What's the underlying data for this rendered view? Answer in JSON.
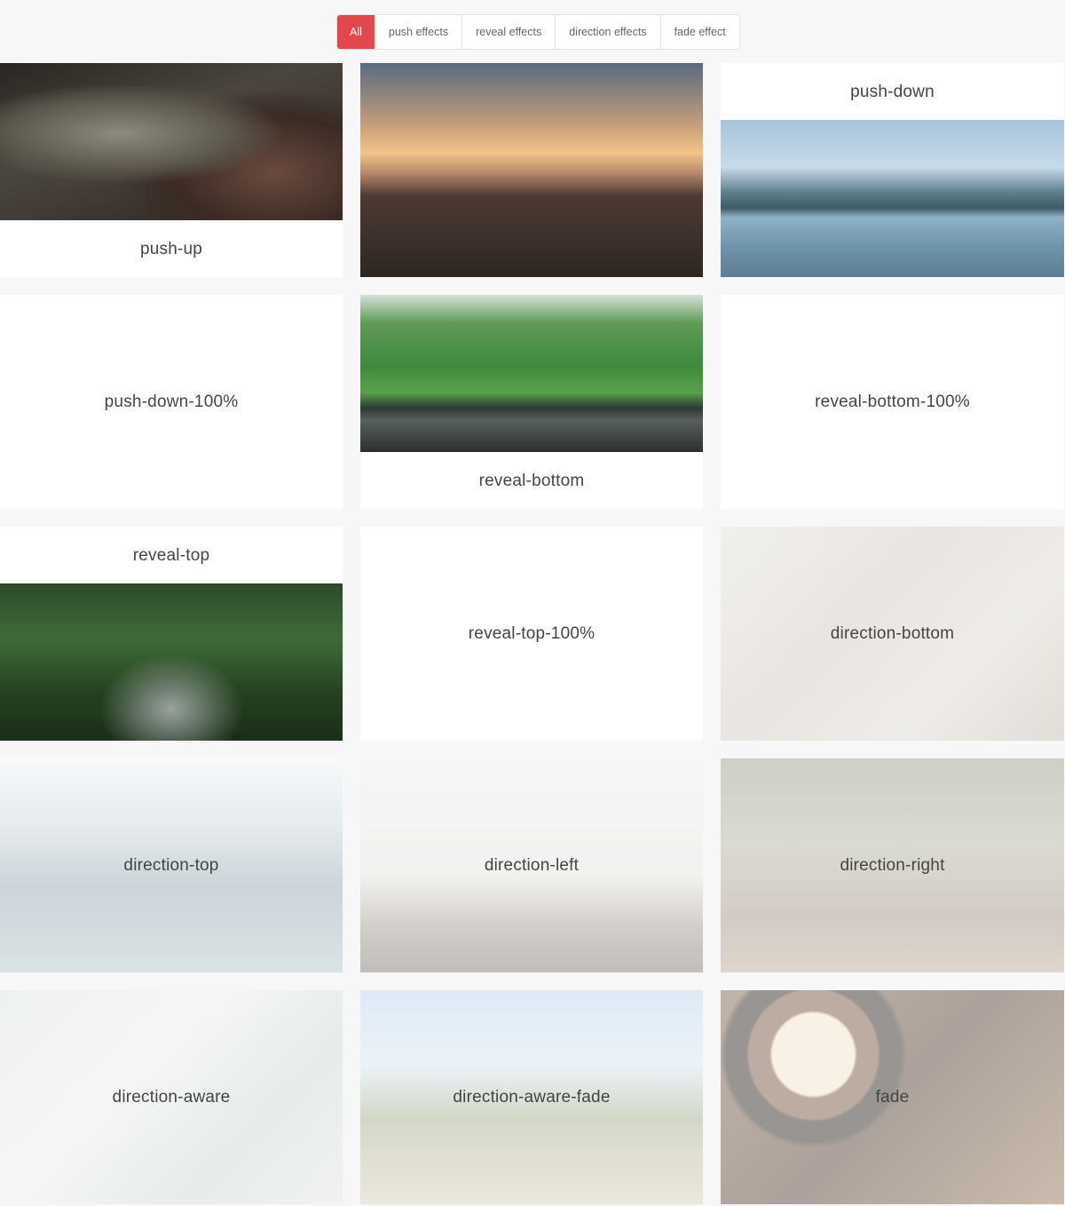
{
  "filters": [
    {
      "label": "All",
      "active": true
    },
    {
      "label": "push effects",
      "active": false
    },
    {
      "label": "reveal effects",
      "active": false
    },
    {
      "label": "direction effects",
      "active": false
    },
    {
      "label": "fade effect",
      "active": false
    }
  ],
  "tiles": [
    {
      "label": "push-up"
    },
    {
      "label": ""
    },
    {
      "label": "push-down"
    },
    {
      "label": "push-down-100%"
    },
    {
      "label": "reveal-bottom"
    },
    {
      "label": "reveal-bottom-100%"
    },
    {
      "label": "reveal-top"
    },
    {
      "label": "reveal-top-100%"
    },
    {
      "label": "direction-bottom"
    },
    {
      "label": "direction-top"
    },
    {
      "label": "direction-left"
    },
    {
      "label": "direction-right"
    },
    {
      "label": "direction-aware"
    },
    {
      "label": "direction-aware-fade"
    },
    {
      "label": "fade"
    }
  ],
  "colors": {
    "accent": "#e2474c",
    "background": "#f7f7f7",
    "tile": "#ffffff"
  }
}
